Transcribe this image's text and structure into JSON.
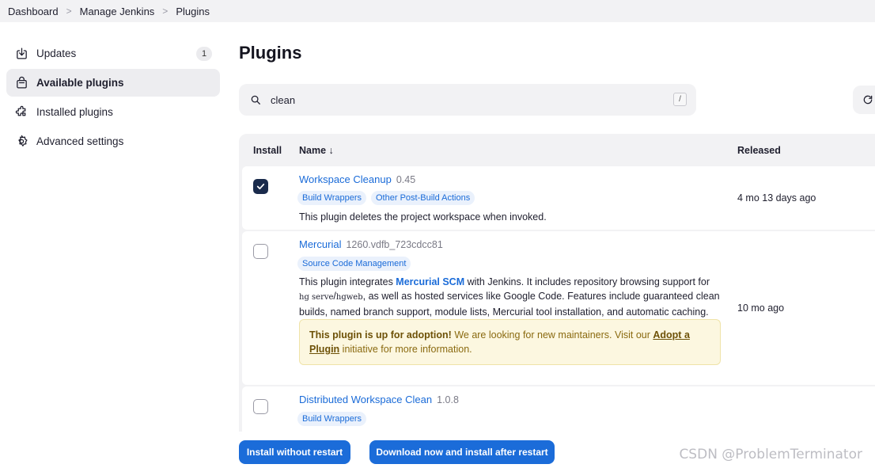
{
  "breadcrumb": [
    "Dashboard",
    "Manage Jenkins",
    "Plugins"
  ],
  "sidebar": {
    "items": [
      {
        "label": "Updates",
        "icon": "download-icon",
        "badge": "1"
      },
      {
        "label": "Available plugins",
        "icon": "shopping-bag-icon",
        "active": true
      },
      {
        "label": "Installed plugins",
        "icon": "puzzle-icon"
      },
      {
        "label": "Advanced settings",
        "icon": "gear-icon"
      }
    ]
  },
  "page_title": "Plugins",
  "search": {
    "value": "clean",
    "shortcut": "/"
  },
  "table": {
    "headers": {
      "install": "Install",
      "name": "Name ↓",
      "released": "Released"
    },
    "rows": [
      {
        "name": "Workspace Cleanup",
        "version": "0.45",
        "tags": [
          "Build Wrappers",
          "Other Post-Build Actions"
        ],
        "excerpt": "This plugin deletes the project workspace when invoked.",
        "released": "4 mo 13 days ago",
        "checked": true
      },
      {
        "name": "Mercurial",
        "version": "1260.vdfb_723cdcc81",
        "tags": [
          "Source Code Management"
        ],
        "excerpt_parts": {
          "p1": "This plugin integrates ",
          "link": "Mercurial SCM",
          "p2": " with Jenkins. It includes repository browsing support for",
          "code1": "hg serve",
          "slash": "/",
          "code2": "hgweb",
          "p3": ", as well as hosted services like Google Code. Features include guaranteed clean",
          "p4": "builds, named branch support, module lists, Mercurial tool installation, and automatic caching."
        },
        "adoption": {
          "strong": "This plugin is up for adoption!",
          "text": " We are looking for new maintainers. Visit our ",
          "link1": "Adopt a",
          "link2": "Plugin",
          "text2": " initiative for more information."
        },
        "released": "10 mo ago",
        "checked": false
      },
      {
        "name": "Distributed Workspace Clean",
        "version": "1.0.8",
        "tags": [
          "Build Wrappers"
        ],
        "checked": false
      }
    ]
  },
  "buttons": {
    "install_without_restart": "Install without restart",
    "download_install_after_restart": "Download now and install after restart"
  },
  "watermark": "CSDN @ProblemTerminator",
  "colors": {
    "accent": "#1b6cd9",
    "dark_check": "#1a2b4c",
    "link": "#1a6bd8"
  }
}
